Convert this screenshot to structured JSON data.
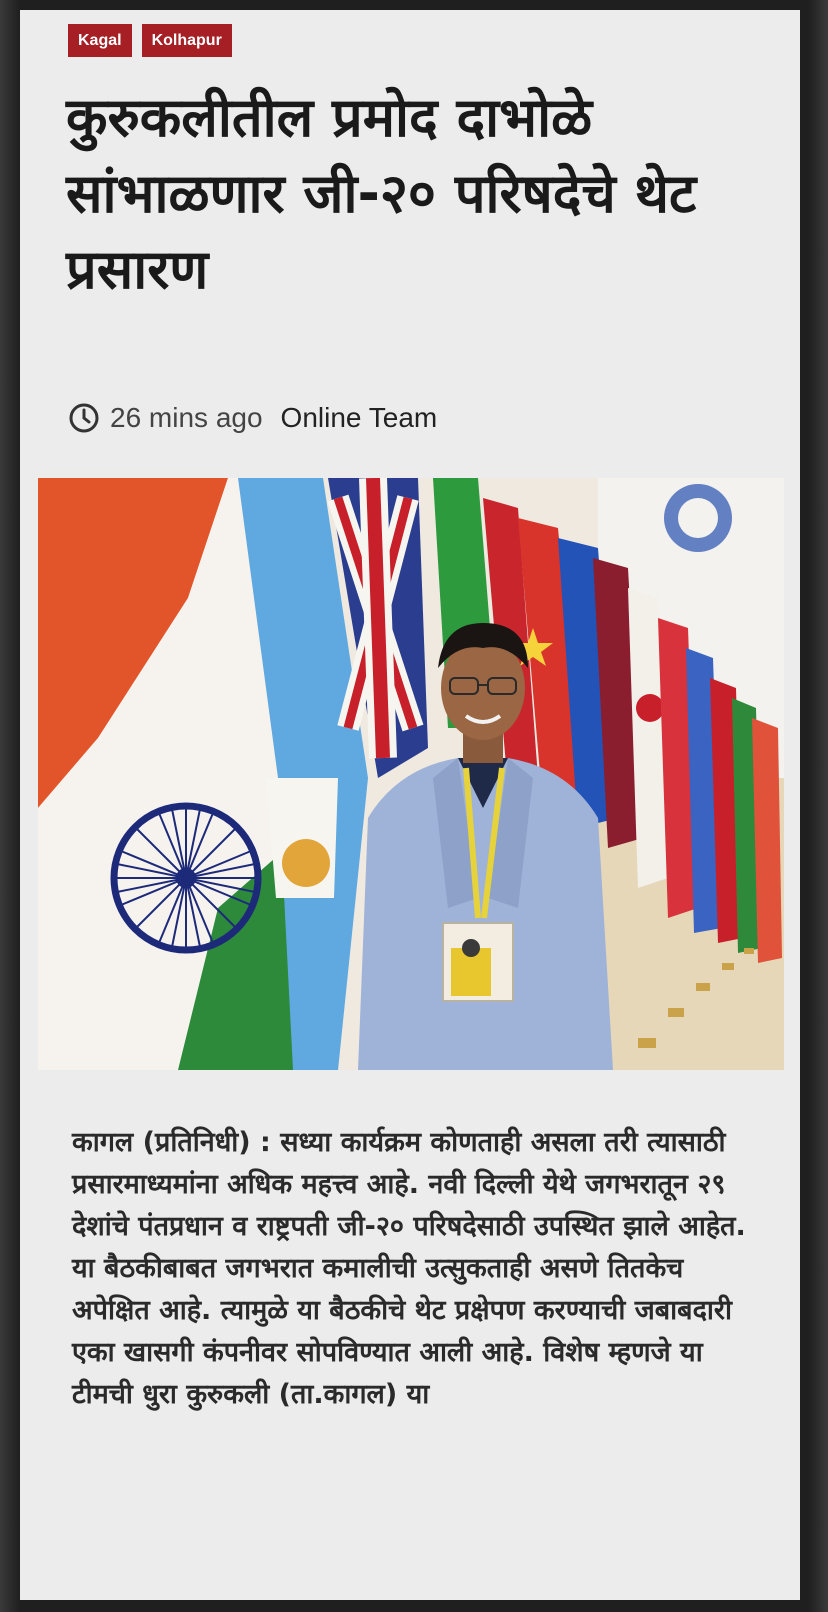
{
  "tags": [
    "Kagal",
    "Kolhapur"
  ],
  "headline": "कुरुकलीतील प्रमोद दाभोळे सांभाळणार जी-२० परिषदेचे थेट प्रसारण",
  "meta": {
    "time_icon": "clock-icon",
    "time": "26 mins ago",
    "author": "Online Team"
  },
  "colors": {
    "tag_bg": "#a51f25",
    "page_bg": "#ececec",
    "text": "#1a1a1a"
  },
  "body": "कागल (प्रतिनिधी) : सध्या कार्यक्रम कोणताही असला तरी त्यासाठी प्रसारमाध्यमांना अधिक महत्त्व आहे. नवी दिल्ली येथे जगभरातून २९ देशांचे पंतप्रधान व राष्ट्रपती जी-२० परिषदेसाठी उपस्थित झाले आहेत. या बैठकीबाबत जगभरात कमालीची उत्सुकताही असणे तितकेच अपेक्षित आहे. त्यामुळे या बैठकीचे थेट प्रक्षेपण करण्याची जबाबदारी एका खासगी कंपनीवर सोपविण्यात आली आहे. विशेष म्हणजे या टीमची धुरा कुरुकली (ता.कागल) या"
}
